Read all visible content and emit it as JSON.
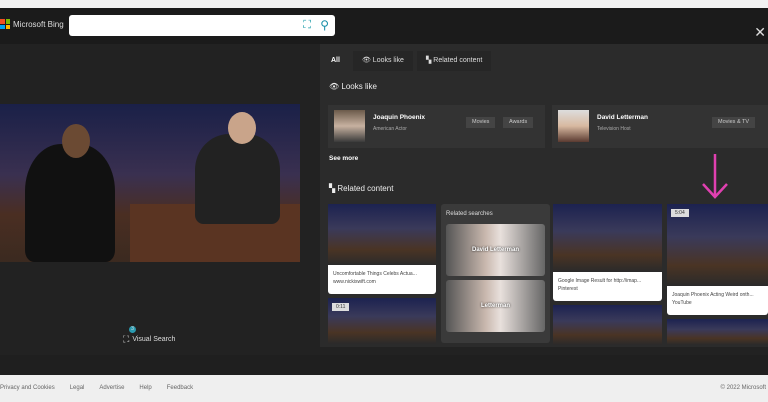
{
  "header": {
    "brand": "Microsoft Bing",
    "search_value": "",
    "icons": [
      "visual-search-icon",
      "search-icon",
      "close-icon"
    ]
  },
  "left": {
    "visual_search_label": "Visual Search",
    "visual_search_badge": "3"
  },
  "tabs": [
    {
      "label": "All",
      "active": true
    },
    {
      "label": "Looks like",
      "icon": "eye-icon"
    },
    {
      "label": "Related content",
      "icon": "grid-icon"
    }
  ],
  "looks_like": {
    "title": "Looks like",
    "people": [
      {
        "name": "Joaquin Phoenix",
        "desc": "American Actor",
        "chips": [
          "Movies",
          "Awards"
        ]
      },
      {
        "name": "David Letterman",
        "desc": "Television Host",
        "chips": [
          "Movies & TV"
        ]
      }
    ],
    "see_more": "See more"
  },
  "related": {
    "title": "Related content",
    "items": [
      {
        "caption": "Uncomfortable Things Celebs Actua...",
        "source": "www.nickiswift.com"
      },
      {
        "duration": "0:11"
      },
      {
        "caption": "Google Image Result for http://imap...",
        "source": "Pinterest"
      },
      {
        "duration": "5:04",
        "caption": "Joaquin Phoenix Acting Weird onth...",
        "source": "YouTube"
      }
    ],
    "related_searches": {
      "title": "Related searches",
      "items": [
        "David Letterman",
        "Letterman"
      ]
    }
  },
  "footer": {
    "links": [
      "Privacy and Cookies",
      "Legal",
      "Advertise",
      "Help",
      "Feedback"
    ],
    "copyright": "© 2022 Microsoft"
  },
  "colors": {
    "accent": "#1a9ba8",
    "annotation_arrow": "#e040b0"
  }
}
